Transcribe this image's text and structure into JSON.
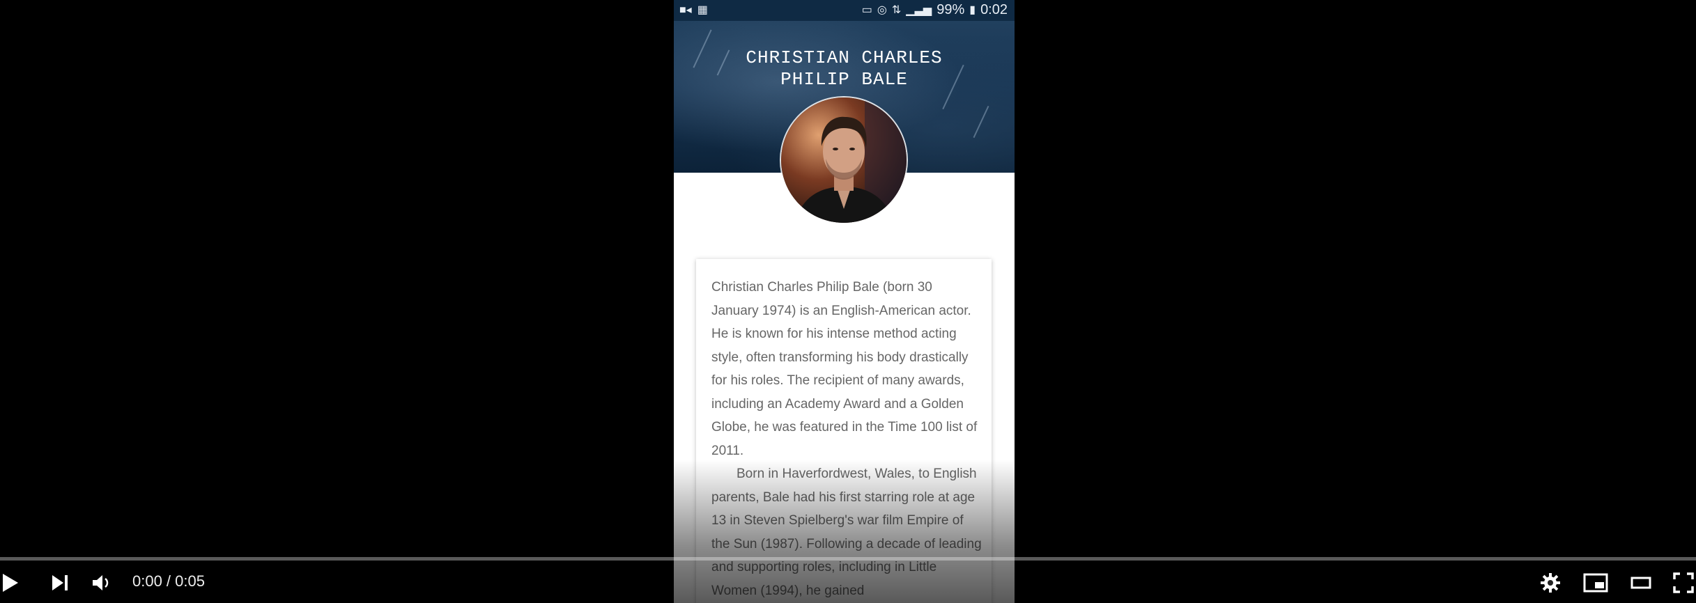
{
  "status_bar": {
    "battery": "99%",
    "time": "0:02"
  },
  "profile": {
    "name_line1": "CHRISTIAN CHARLES",
    "name_line2": "PHILIP BALE"
  },
  "bio": {
    "paragraph1": "Christian Charles Philip Bale (born 30 January 1974) is an English-American actor. He is known for his intense method acting style, often transforming his body drastically for his roles. The recipient of many awards, including an Academy Award and a Golden Globe, he was featured in the Time 100 list of 2011.",
    "paragraph2": "Born in Haverfordwest, Wales, to English parents, Bale had his first starring role at age 13 in Steven Spielberg's war film Empire of the Sun (1987). Following a decade of leading and supporting roles, including in Little Women (1994), he gained"
  },
  "player": {
    "time_display": "0:00 / 0:05",
    "progress": 0.0,
    "icons": [
      "play-icon",
      "next-icon",
      "volume-icon",
      "settings-icon",
      "miniplayer-icon",
      "theater-mode-icon",
      "fullscreen-icon"
    ]
  }
}
